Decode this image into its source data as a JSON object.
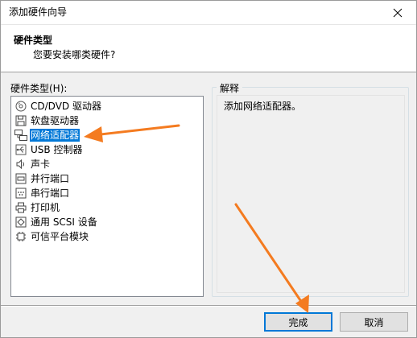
{
  "window": {
    "title": "添加硬件向导"
  },
  "header": {
    "title": "硬件类型",
    "subtitle": "您要安装哪类硬件?"
  },
  "hardware_list": {
    "label": "硬件类型(H):",
    "items": [
      {
        "label": "CD/DVD 驱动器",
        "icon": "cd-dvd-icon"
      },
      {
        "label": "软盘驱动器",
        "icon": "floppy-icon"
      },
      {
        "label": "网络适配器",
        "icon": "network-adapter-icon",
        "selected": true
      },
      {
        "label": "USB 控制器",
        "icon": "usb-icon"
      },
      {
        "label": "声卡",
        "icon": "sound-icon"
      },
      {
        "label": "并行端口",
        "icon": "parallel-port-icon"
      },
      {
        "label": "串行端口",
        "icon": "serial-port-icon"
      },
      {
        "label": "打印机",
        "icon": "printer-icon"
      },
      {
        "label": "通用 SCSI 设备",
        "icon": "scsi-icon"
      },
      {
        "label": "可信平台模块",
        "icon": "tpm-icon"
      }
    ]
  },
  "explanation": {
    "legend": "解释",
    "text": "添加网络适配器。"
  },
  "buttons": {
    "finish": "完成",
    "cancel": "取消"
  },
  "colors": {
    "selection": "#0078d7",
    "annotation_arrow": "#f47b20"
  }
}
